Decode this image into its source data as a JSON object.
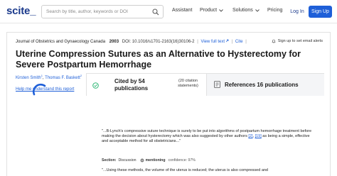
{
  "header": {
    "logo": "scite_",
    "search_placeholder": "Search by title, author, keywords or DOI",
    "nav": {
      "assistant": "Assistant",
      "product": "Product",
      "solutions": "Solutions",
      "pricing": "Pricing",
      "login": "Log In",
      "signup": "Sign Up"
    }
  },
  "article": {
    "journal": "Journal of Obstetrics and Gynaecology Canada",
    "year": "2003",
    "doi": "DOI: 10.1016/s1701-2163(16)30106-2",
    "view_full_text": "View full text",
    "cite": "Cite",
    "alert": "Sign up to set email alerts",
    "title": "Uterine Compression Sutures as an Alternative to Hysterectomy for Severe Postpartum Hemorrhage",
    "author1": "Kirsten Smith",
    "author1_sup": "1",
    "author_sep": ", ",
    "author2": "Thomas F. Baskett",
    "author2_sup": "2",
    "help_link": "Help me understand this report"
  },
  "tabs": {
    "cited_label": "Cited by 54 publications",
    "cited_sub": "(20 citation statements)",
    "refs_label": "References 16 publications"
  },
  "snippet": {
    "quote_a": "\"...B-Lynch's compressive suture technique is surely to be put into algorithms of postpartum hemorrhage treatment before making the decision about hysterectomy which was also suggested by other authors ",
    "ref1": "[2]",
    "ref2": "[19]",
    "quote_b": " as being a simple, effective and acceptable method for all obstetricians...\"",
    "section_label": "Section:",
    "section_value": "Discussion",
    "mention": "mentioning",
    "confidence": "confidence: 97%",
    "quote2": "\"...Using these methods, the volume of the uterus is reduced; the uterus is also compressed and"
  },
  "colors": {
    "brand": "#1b3a8c",
    "accent": "#1e5fd8",
    "mentioning_icon": "#7d7d7d",
    "cited_icon": "#2bb673"
  }
}
